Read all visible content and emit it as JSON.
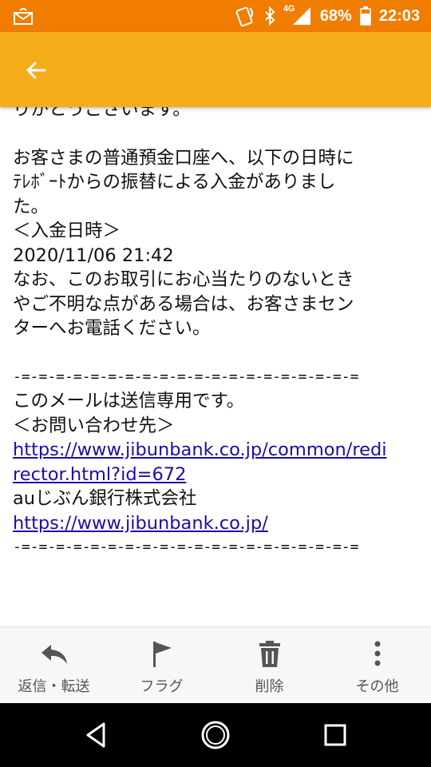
{
  "status_bar": {
    "network": "4G",
    "battery": "68%",
    "time": "22:03"
  },
  "app_bar": {
    "back_icon": "arrow-left-icon",
    "accent": "#f5ac19",
    "status_color": "#f07d00"
  },
  "email": {
    "partial_line": "りがとうございます。",
    "para1": [
      "お客さまの普通預金口座へ、以下の日時に",
      "ﾃﾚﾎﾞｰﾄからの振替による入金がありまし",
      "た。"
    ],
    "deposit_heading": "＜入金日時＞",
    "deposit_datetime": "2020/11/06 21:42",
    "para2": [
      "なお、このお取引にお心当たりのないとき",
      "やご不明な点がある場合は、お客さまセン",
      "ターへお電話ください。"
    ],
    "divider": "-=-=-=-=-=-=-=-=-=-=-=-=-=-=-=-=-=-=-=-=",
    "notice": "このメールは送信専用です。",
    "contact_heading": "＜お問い合わせ先＞",
    "link1_lines": [
      "https://www.jibunbank.co.jp/common/redi",
      "rector.html?id=672"
    ],
    "company": "auじぶん銀行株式会社",
    "link2": "https://www.jibunbank.co.jp/"
  },
  "actions": [
    {
      "icon": "reply-icon",
      "label": "返信・転送"
    },
    {
      "icon": "flag-icon",
      "label": "フラグ"
    },
    {
      "icon": "trash-icon",
      "label": "削除"
    },
    {
      "icon": "more-vert-icon",
      "label": "その他"
    }
  ]
}
